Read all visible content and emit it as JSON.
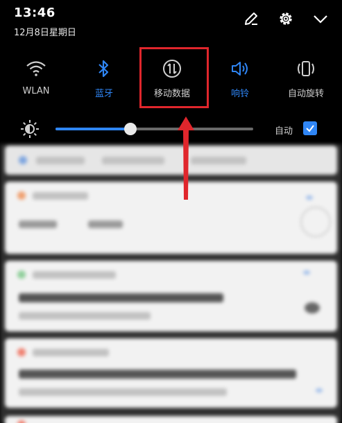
{
  "status": {
    "time": "13:46",
    "date": "12月8日星期日"
  },
  "top_icons": [
    "edit-icon",
    "settings-gear-icon",
    "chevron-down-icon"
  ],
  "toggles": [
    {
      "label": "WLAN",
      "icon": "wifi-icon",
      "active": false
    },
    {
      "label": "蓝牙",
      "icon": "bluetooth-icon",
      "active": true
    },
    {
      "label": "移动数据",
      "icon": "mobile-data-icon",
      "active": false
    },
    {
      "label": "响铃",
      "icon": "volume-icon",
      "active": true
    },
    {
      "label": "自动旋转",
      "icon": "auto-rotate-icon",
      "active": false
    }
  ],
  "brightness": {
    "level": 0.38,
    "auto_label": "自动",
    "auto_checked": true
  },
  "colors": {
    "accent": "#2f86f6",
    "highlight": "#e0262c",
    "background": "#000000"
  }
}
